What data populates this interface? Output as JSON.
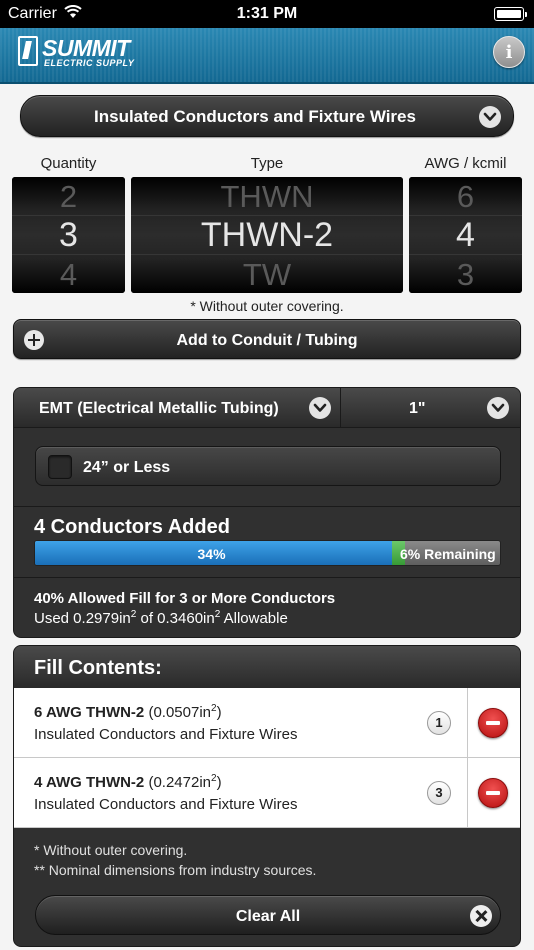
{
  "status_bar": {
    "carrier": "Carrier",
    "time": "1:31 PM"
  },
  "header": {
    "brand_name": "SUMMIT",
    "brand_sub": "ELECTRIC SUPPLY",
    "info_label": "i"
  },
  "category": {
    "label": "Insulated Conductors and Fixture Wires"
  },
  "picker": {
    "columns": [
      {
        "header": "Quantity",
        "above": "2",
        "selected": "3",
        "below": "4"
      },
      {
        "header": "Type",
        "above": "THWN",
        "selected": "THWN-2",
        "below": "TW"
      },
      {
        "header": "AWG / kcmil",
        "above": "6",
        "selected": "4",
        "below": "3"
      }
    ],
    "footnote": "* Without outer covering."
  },
  "add_button": {
    "label": "Add to Conduit / Tubing"
  },
  "conduit": {
    "type": "EMT (Electrical Metallic Tubing)",
    "size": "1\"",
    "length_option": "24” or Less",
    "length_checked": false,
    "conductors_added": "4 Conductors Added",
    "fill_used_percent": 34,
    "fill_remaining_percent": 6,
    "used_label": "34%",
    "remaining_label": "6% Remaining",
    "rule": "40% Allowed Fill for 3 or More Conductors",
    "used_prefix": "Used 0.2979in",
    "used_mid": " of 0.3460in",
    "used_suffix": " Allowable",
    "exponent": "2"
  },
  "fill_contents": {
    "title": "Fill Contents:",
    "items": [
      {
        "name": "6 AWG THWN-2",
        "area_prefix": "(0.0507in",
        "area_suffix": ")",
        "exp": "2",
        "category": "Insulated Conductors and Fixture Wires",
        "count": "1"
      },
      {
        "name": "4 AWG THWN-2",
        "area_prefix": "(0.2472in",
        "area_suffix": ")",
        "exp": "2",
        "category": "Insulated Conductors and Fixture Wires",
        "count": "3"
      }
    ],
    "note_1": "* Without outer covering.",
    "note_2": "** Nominal dimensions from industry sources.",
    "clear_label": "Clear All"
  }
}
